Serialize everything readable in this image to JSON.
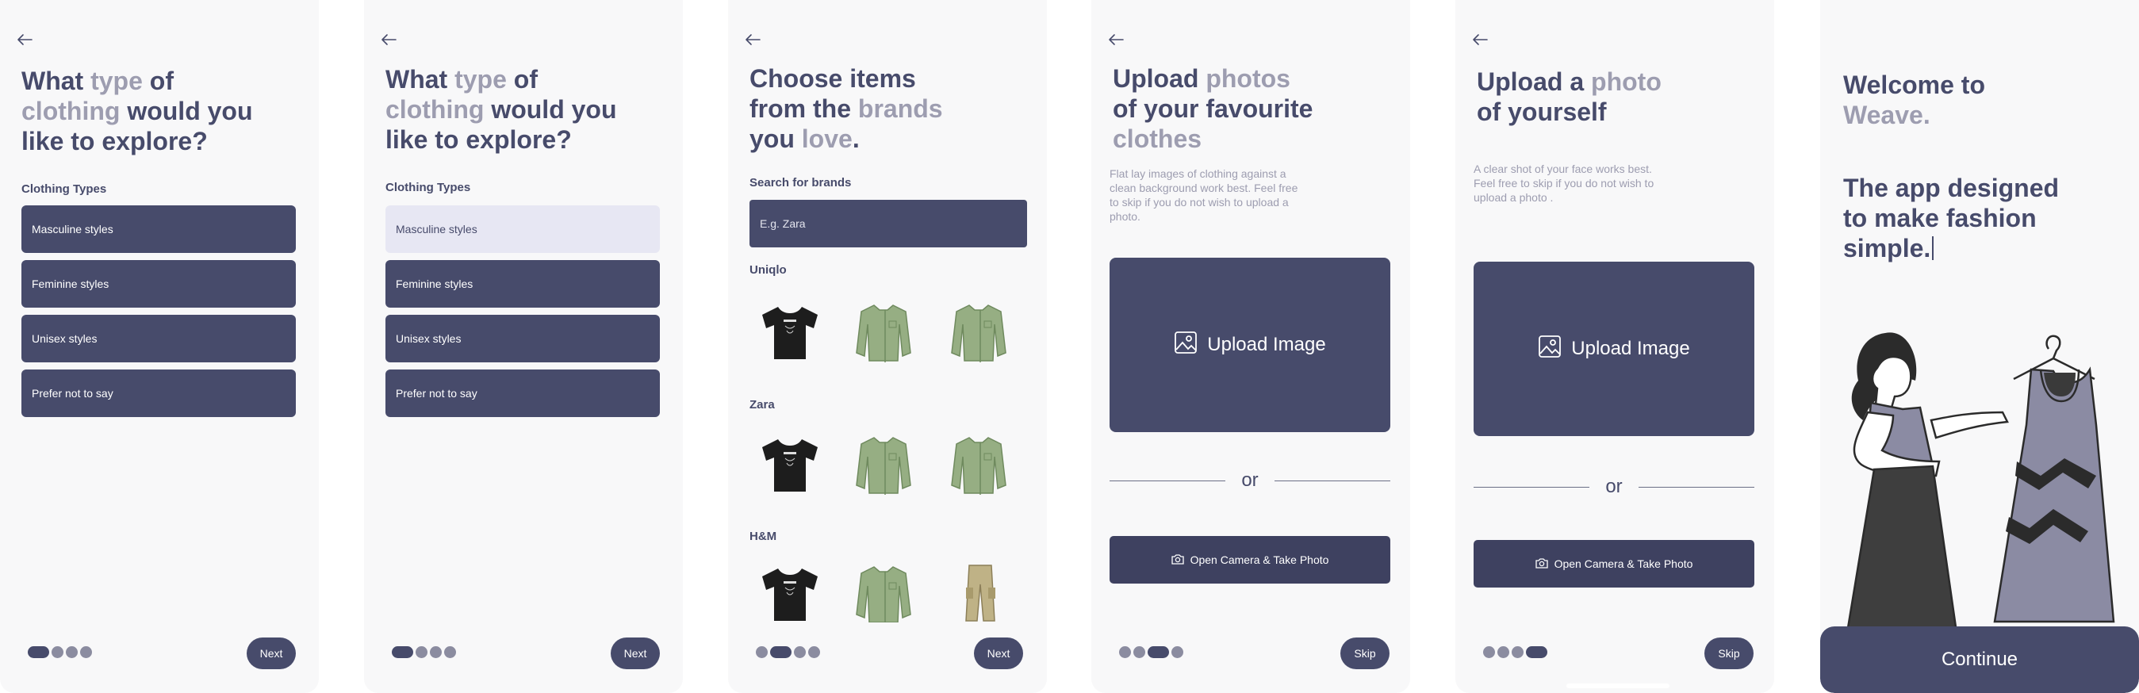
{
  "colors": {
    "primary": "#474b6b",
    "muted": "#9d9db0",
    "selected": "#e7e7f3",
    "background": "#f8f8f9"
  },
  "screens": [
    {
      "title": {
        "l1a": "What ",
        "l1b": "type",
        "l1c": " of",
        "l2a": "clothing",
        "l2b": " would you",
        "l3": "like to explore?"
      },
      "section": "Clothing Types",
      "options": [
        "Masculine styles",
        "Feminine styles",
        "Unisex styles",
        "Prefer not to say"
      ],
      "progress_step": 1,
      "progress_total": 4,
      "button": "Next"
    },
    {
      "title": {
        "l1a": "What ",
        "l1b": "type",
        "l1c": " of",
        "l2a": "clothing",
        "l2b": " would you",
        "l3": "like to explore?"
      },
      "section": "Clothing Types",
      "options": [
        "Masculine styles",
        "Feminine styles",
        "Unisex styles",
        "Prefer not to say"
      ],
      "selected_option": "Masculine styles",
      "progress_step": 1,
      "progress_total": 4,
      "button": "Next"
    },
    {
      "title": {
        "l1": "Choose items",
        "l2a": "from the ",
        "l2b": "brands",
        "l3a": "you ",
        "l3b": "love",
        "l3c": "."
      },
      "search_label": "Search for brands",
      "search_placeholder": "E.g. Zara",
      "brands": [
        {
          "name": "Uniqlo",
          "items": [
            "black-tshirt-icon",
            "green-shirt-icon",
            "green-shirt-icon"
          ]
        },
        {
          "name": "Zara",
          "items": [
            "black-tshirt-icon",
            "green-shirt-icon",
            "green-shirt-icon"
          ]
        },
        {
          "name": "H&M",
          "items": [
            "black-tshirt-icon",
            "green-shirt-icon",
            "cargo-pants-icon"
          ]
        }
      ],
      "progress_step": 2,
      "progress_total": 4,
      "button": "Next"
    },
    {
      "title": {
        "l1a": "Upload ",
        "l1b": "photos",
        "l2": "of your favourite",
        "l3": "clothes"
      },
      "subtitle_lines": [
        "Flat lay images of clothing against a",
        "clean background work best. Feel free",
        "to skip if you do not wish to upload a",
        "photo."
      ],
      "upload_label": "Upload Image",
      "or_label": "or",
      "camera_label": "Open Camera & Take Photo",
      "progress_step": 3,
      "progress_total": 4,
      "button": "Skip"
    },
    {
      "title": {
        "l1a": "Upload a ",
        "l1b": "photo",
        "l2": "of yourself"
      },
      "subtitle_lines": [
        "A clear shot of your face works best.",
        "Feel free to skip if you do not wish to",
        "upload a photo ."
      ],
      "upload_label": "Upload Image",
      "or_label": "or",
      "camera_label": "Open Camera & Take Photo",
      "progress_step": 4,
      "progress_total": 4,
      "button": "Skip"
    },
    {
      "welcome_l1": "Welcome to",
      "welcome_l2": "Weave.",
      "tagline": "The app designed to make fashion simple.",
      "illustration": "woman-holding-dress-illustration",
      "button": "Continue"
    }
  ]
}
